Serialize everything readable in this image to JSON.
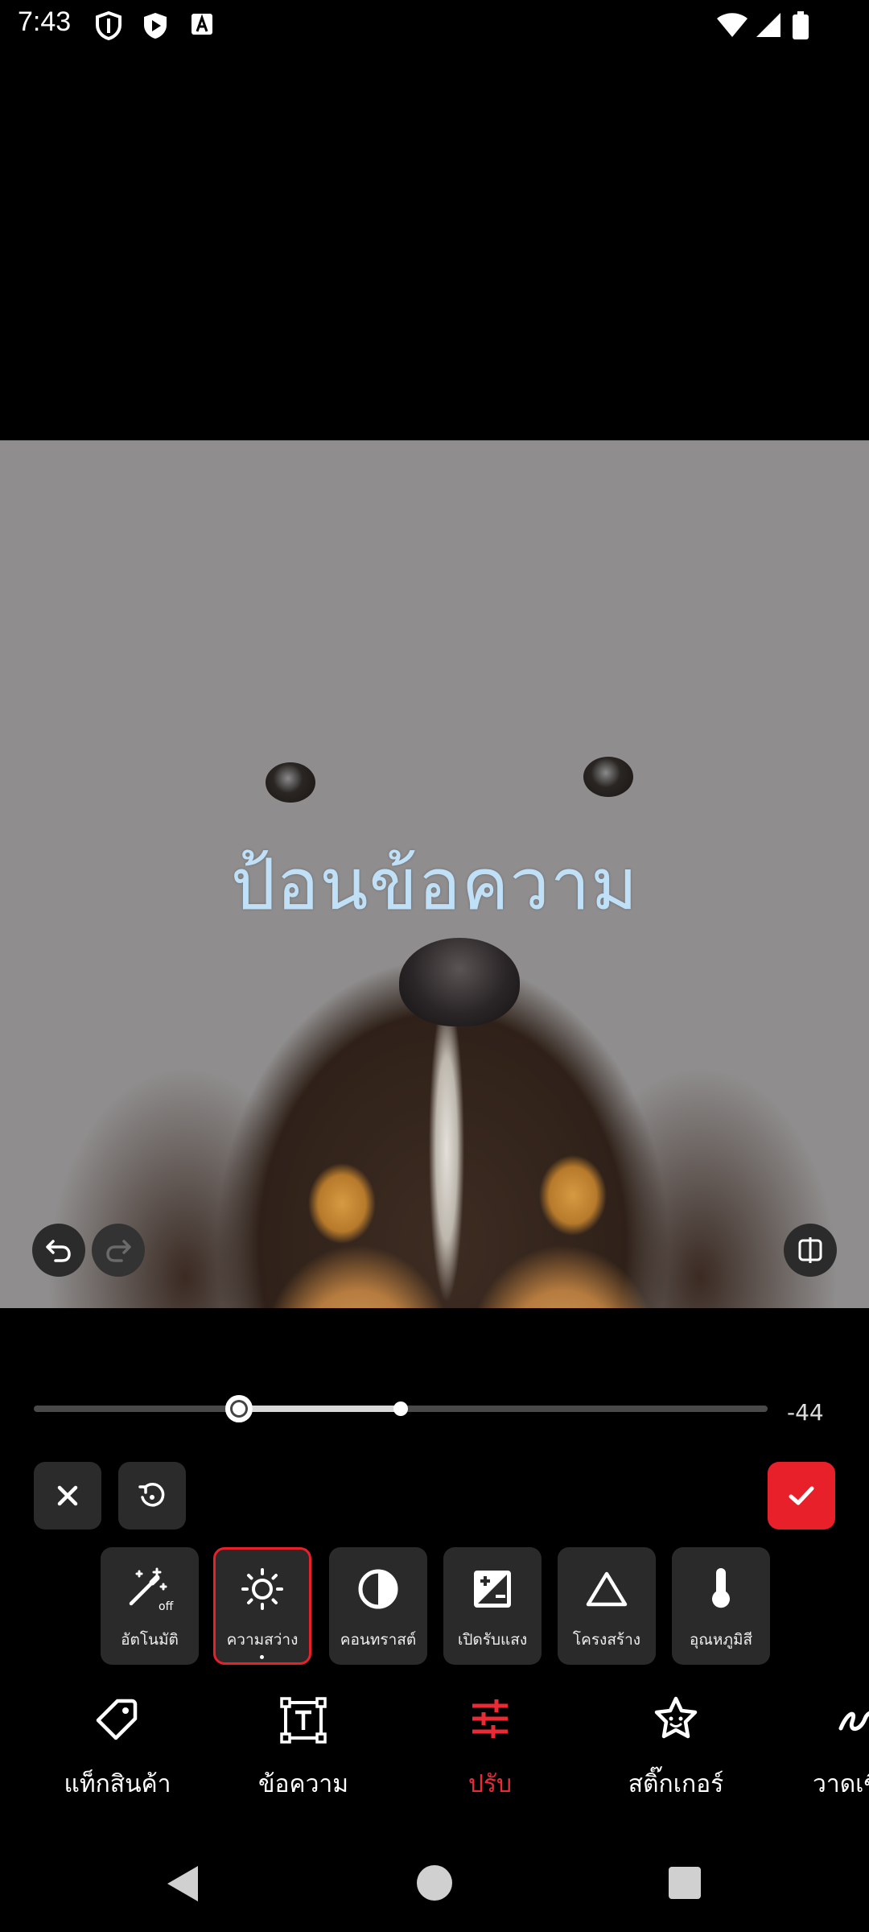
{
  "status_bar": {
    "time": "7:43"
  },
  "editor": {
    "overlay_text": "ป้อนข้อความ",
    "slider": {
      "value_label": "-44",
      "value": -44,
      "min": -100,
      "max": 100
    }
  },
  "adjust_tools": [
    {
      "label": "อัตโนมัติ",
      "icon": "magic-wand-off-icon",
      "badge": "off"
    },
    {
      "label": "ความสว่าง",
      "icon": "brightness-icon",
      "selected": true
    },
    {
      "label": "คอนทราสต์",
      "icon": "contrast-icon"
    },
    {
      "label": "เปิดรับแสง",
      "icon": "exposure-icon"
    },
    {
      "label": "โครงสร้าง",
      "icon": "structure-triangle-icon"
    },
    {
      "label": "อุณหภูมิสี",
      "icon": "thermometer-icon"
    }
  ],
  "bottom_nav": [
    {
      "label": "แท็กสินค้า",
      "icon": "tag-icon"
    },
    {
      "label": "ข้อความ",
      "icon": "text-box-icon"
    },
    {
      "label": "ปรับ",
      "icon": "sliders-icon",
      "active": true
    },
    {
      "label": "สติ๊กเกอร์",
      "icon": "sticker-icon"
    },
    {
      "label": "วาดเขี",
      "icon": "draw-icon"
    }
  ],
  "colors": {
    "accent": "#e8202a",
    "background": "#000000",
    "tool_bg": "#2a2a2a"
  }
}
